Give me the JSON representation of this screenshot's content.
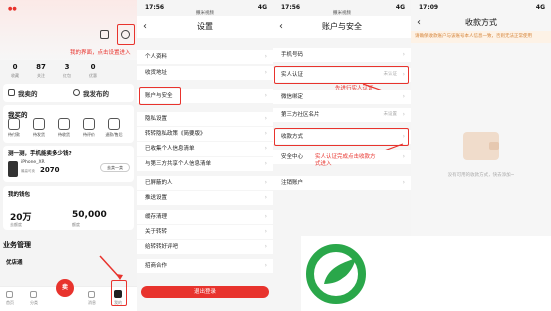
{
  "panel1": {
    "time": "",
    "stats": [
      {
        "value": "0",
        "label": "收藏"
      },
      {
        "value": "87",
        "label": "关注"
      },
      {
        "value": "3",
        "label": "红包"
      },
      {
        "value": "0",
        "label": "优惠"
      }
    ],
    "annotation": "我的界面，点击设置进入",
    "tabs_row1": [
      "我卖的",
      "我发布的"
    ],
    "my_buy_title": "我买的",
    "buy_items": [
      "待付款",
      "待发货",
      "待收货",
      "待评价",
      "退款/售后"
    ],
    "sell_prompt": "测一测，手机能卖多少钱?",
    "phone_model": "iPhone_XR",
    "price_label": "最高可卖",
    "price": "2070",
    "sell_button": "去卖一卖",
    "wallet_title": "我的钱包",
    "wallet_a_value": "20万",
    "wallet_a_label": "去额度",
    "wallet_b_value": "50,000",
    "wallet_b_label": "额度",
    "biz_title": "业务管理",
    "biz_item": "优店通",
    "tabs": [
      "首页",
      "分类",
      "卖",
      "消息",
      "我的"
    ],
    "sell_tab": "卖"
  },
  "panel2": {
    "time": "17:56",
    "carrier": "4G",
    "sub": "撒米视频",
    "title": "设置",
    "back": "‹",
    "rows": [
      "个人资料",
      "收货地址",
      "账户与安全",
      "隐私设置",
      "转转隐私政策《简要版》",
      "已收集个人信息清单",
      "与第三方共享个人信息清单",
      "已屏蔽的人",
      "推送设置",
      "缓存清理",
      "关于转转",
      "给转转好评吧",
      "招商合作"
    ],
    "logout": "退出登录"
  },
  "panel3": {
    "time": "17:56",
    "carrier": "4G",
    "sub": "撒米视频",
    "title": "账户与安全",
    "back": "‹",
    "rows": [
      {
        "label": "手机号码",
        "value": ""
      },
      {
        "label": "实人认证",
        "value": "未认证"
      },
      {
        "label": "微信绑定",
        "value": ""
      },
      {
        "label": "第三方社区名片",
        "value": "未设置"
      },
      {
        "label": "收款方式",
        "value": ""
      },
      {
        "label": "安全中心",
        "value": ""
      },
      {
        "label": "注销账户",
        "value": ""
      }
    ],
    "note1": "先进行实人认证",
    "note2": "实人认证完成点击收款方式进入"
  },
  "panel4": {
    "time": "17:09",
    "carrier": "4G",
    "title": "收款方式",
    "back": "‹",
    "warning": "请确保收款账户与该账号本人信息一致，否则无法正常使用",
    "empty": "没有可用的收款方式，快去添加~"
  },
  "colors": {
    "accent": "#e8332d",
    "logo_green": "#2aa74a"
  },
  "logo_icon": "leaf-logo"
}
